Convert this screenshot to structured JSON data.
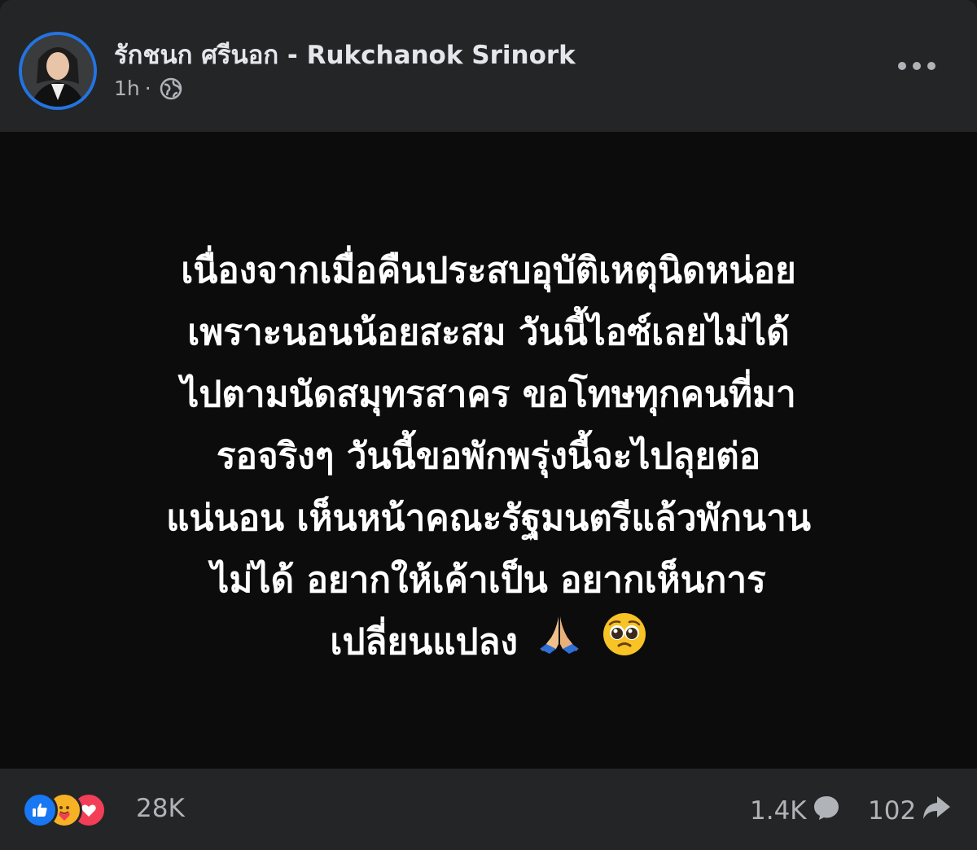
{
  "post": {
    "author_name": "รักชนก ศรีนอก - Rukchanok Srinork",
    "time": "1h",
    "separator": "·",
    "audience_icon": "globe-icon",
    "more_icon": "more-options-icon",
    "text_lines": [
      "เนื่องจากเมื่อคืนประสบอุบัติเหตุนิดหน่อย",
      "เพราะนอนน้อยสะสม วันนี้ไอซ์เลยไม่ได้",
      "ไปตามนัดสมุทรสาคร ขอโทษทุกคนที่มา",
      "รอจริงๆ วันนี้ขอพักพรุ่งนี้จะไปลุยต่อ",
      "แน่นอน เห็นหน้าคณะรัฐมนตรีแล้วพักนาน",
      "ไม่ได้ อยากให้เค้าเป็น อยากเห็นการ",
      "เปลี่ยนแปลง"
    ],
    "emojis": [
      "folded-hands-icon",
      "pleading-face-icon"
    ]
  },
  "footer": {
    "reactions": [
      "like-icon",
      "care-icon",
      "love-icon"
    ],
    "reaction_count": "28K",
    "comment_count": "1.4K",
    "share_count": "102"
  },
  "colors": {
    "header_bg": "#242526",
    "body_bg": "#0c0c0c",
    "text": "#ffffff",
    "secondary_text": "#b0b3b8",
    "avatar_ring": "#2374e1",
    "like": "#1877f2",
    "care": "#f7b125",
    "love": "#f33e58"
  }
}
